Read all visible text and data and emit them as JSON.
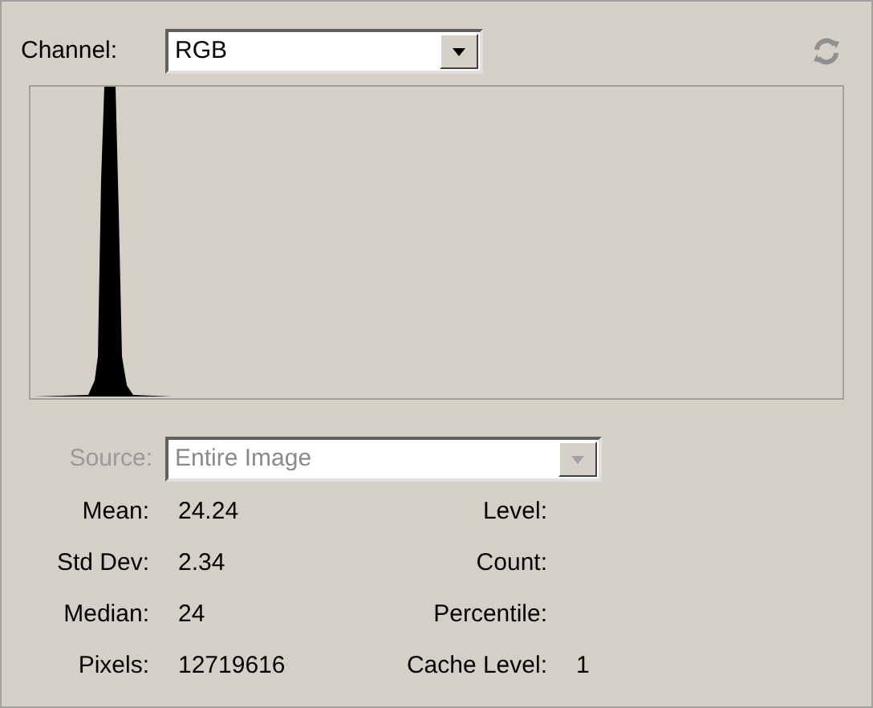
{
  "channel": {
    "label": "Channel:",
    "value": "RGB"
  },
  "source": {
    "label": "Source:",
    "value": "Entire Image",
    "disabled": true
  },
  "stats_left": [
    {
      "label": "Mean:",
      "value": "24.24"
    },
    {
      "label": "Std Dev:",
      "value": "2.34"
    },
    {
      "label": "Median:",
      "value": "24"
    },
    {
      "label": "Pixels:",
      "value": "12719616"
    }
  ],
  "stats_right": [
    {
      "label": "Level:"
    },
    {
      "label": "Count:"
    },
    {
      "label": "Percentile:"
    },
    {
      "label": "Cache Level:",
      "value": "1"
    }
  ]
}
